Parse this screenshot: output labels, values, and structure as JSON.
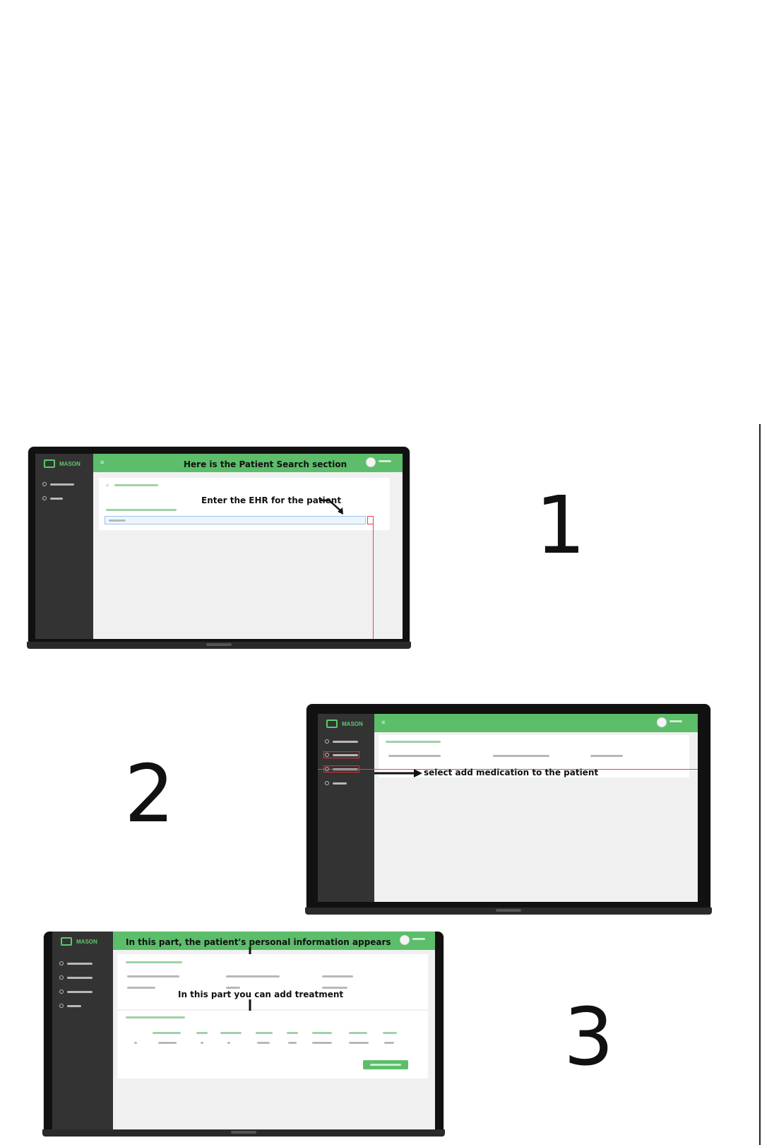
{
  "step1": {
    "number": "1",
    "banner": "Here is the Patient Search section",
    "annotation": "Enter the EHR for the patient"
  },
  "step2": {
    "number": "2",
    "annotation": "select add medication to the patient"
  },
  "step3": {
    "number": "3",
    "banner": "In this part, the patient's personal information appears",
    "annotation": "In this part you can add treatment"
  },
  "colors": {
    "accent": "#5cbd6a",
    "sidebar": "#333333",
    "highlight": "#e04a4a"
  }
}
